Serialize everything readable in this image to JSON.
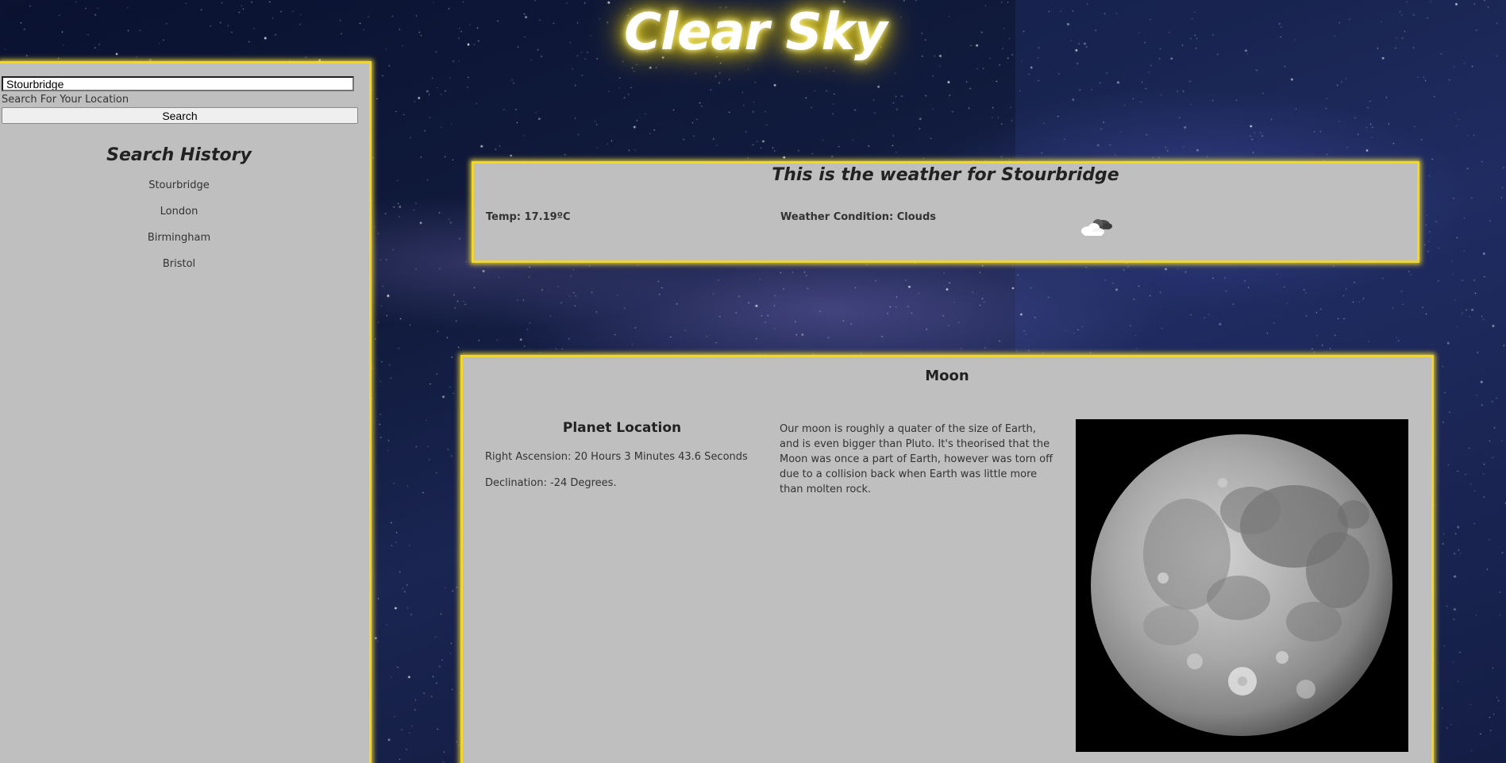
{
  "site": {
    "title": "Clear Sky"
  },
  "sidebar": {
    "search_value": "Stourbridge",
    "search_label": "Search For Your Location",
    "search_button": "Search",
    "history_title": "Search History",
    "history": [
      "Stourbridge",
      "London",
      "Birmingham",
      "Bristol"
    ]
  },
  "weather": {
    "heading": "This is the weather for Stourbridge",
    "temp": "Temp: 17.19ºC",
    "condition": "Weather Condition: Clouds",
    "icon": "cloud-icon"
  },
  "planet": {
    "name": "Moon",
    "location_title": "Planet Location",
    "right_ascension": "Right Ascension: 20 Hours 3 Minutes 43.6 Seconds",
    "declination": "Declination: -24 Degrees.",
    "description": "Our moon is roughly a quater of the size of Earth, and is even bigger than Pluto. It's theorised that the Moon was once a part of Earth, however was torn off due to a collision back when Earth was little more than molten rock.",
    "image": "moon-photo"
  },
  "colors": {
    "panel_background": "#bfbfbf",
    "panel_border": "#f0d62e",
    "title_glow": "#e6c900"
  }
}
